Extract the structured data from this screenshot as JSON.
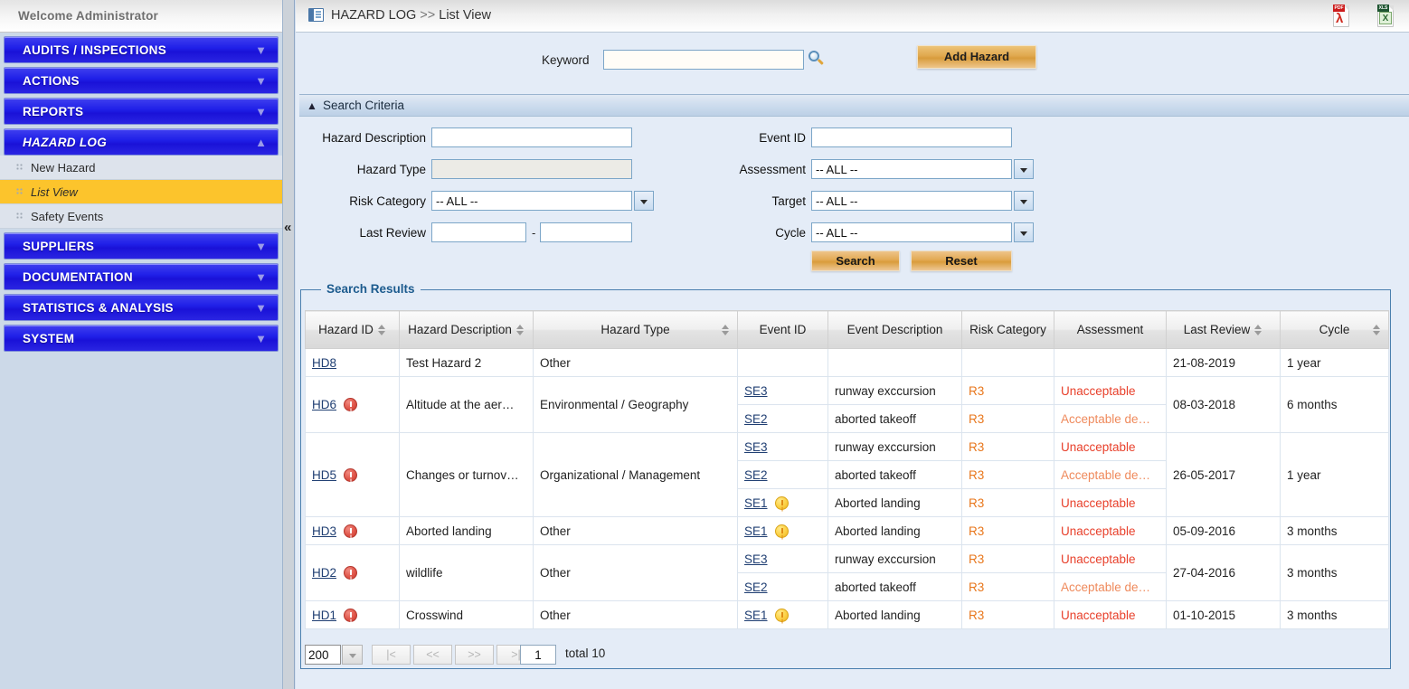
{
  "sidebar": {
    "welcome": "Welcome  Administrator",
    "groups": [
      {
        "label": "AUDITS / INSPECTIONS",
        "open": false,
        "chevron": "▼"
      },
      {
        "label": "ACTIONS",
        "open": false,
        "chevron": "▼"
      },
      {
        "label": "REPORTS",
        "open": false,
        "chevron": "▼"
      },
      {
        "label": "HAZARD LOG",
        "open": true,
        "chevron": "▲"
      },
      {
        "label": "SUPPLIERS",
        "open": false,
        "chevron": "▼"
      },
      {
        "label": "DOCUMENTATION",
        "open": false,
        "chevron": "▼"
      },
      {
        "label": "STATISTICS & ANALYSIS",
        "open": false,
        "chevron": "▼"
      },
      {
        "label": "SYSTEM",
        "open": false,
        "chevron": "▼"
      }
    ],
    "hazard_log_items": [
      {
        "label": "New Hazard",
        "active": false
      },
      {
        "label": "List View",
        "active": true
      },
      {
        "label": "Safety Events",
        "active": false
      }
    ],
    "collapse_glyph": "«"
  },
  "titlebar": {
    "breadcrumb_root": "HAZARD LOG",
    "breadcrumb_sep": ">>",
    "breadcrumb_leaf": "List View",
    "pdf_tag": "PDF",
    "pdf_glyph": "λ",
    "xls_tag": "XLS",
    "xls_glyph": "X"
  },
  "keyword_bar": {
    "label": "Keyword",
    "value": "",
    "placeholder": "",
    "add_hazard_label": "Add Hazard"
  },
  "criteria": {
    "title": "Search Criteria",
    "caret": "▲",
    "hazard_description_label": "Hazard Description",
    "hazard_description_value": "",
    "hazard_type_label": "Hazard Type",
    "hazard_type_value": "",
    "risk_category_label": "Risk Category",
    "risk_category_value": "-- ALL --",
    "last_review_label": "Last Review",
    "last_review_from": "",
    "last_review_to": "",
    "last_review_sep": "-",
    "event_id_label": "Event ID",
    "event_id_value": "",
    "assessment_label": "Assessment",
    "assessment_value": "-- ALL --",
    "target_label": "Target",
    "target_value": "-- ALL --",
    "cycle_label": "Cycle",
    "cycle_value": "-- ALL --",
    "search_label": "Search",
    "reset_label": "Reset"
  },
  "results": {
    "legend": "Search Results",
    "columns": [
      {
        "label": "Hazard ID",
        "sortable": true
      },
      {
        "label": "Hazard Description",
        "sortable": true
      },
      {
        "label": "Hazard Type",
        "sortable": true
      },
      {
        "label": "Event ID",
        "sortable": false
      },
      {
        "label": "Event Description",
        "sortable": false
      },
      {
        "label": "Risk Category",
        "sortable": false
      },
      {
        "label": "Assessment",
        "sortable": false
      },
      {
        "label": "Last Review",
        "sortable": true
      },
      {
        "label": "Cycle",
        "sortable": true
      }
    ],
    "rows": [
      {
        "hazard_id": "HD8",
        "hazard_flag": false,
        "hazard_description": "Test Hazard 2",
        "hazard_type": "Other",
        "last_review": "21-08-2019",
        "cycle": "1 year",
        "events": [
          {
            "event_id": "",
            "event_flag": false,
            "event_description": "",
            "risk_category": "",
            "assessment": "",
            "assessment_kind": ""
          }
        ]
      },
      {
        "hazard_id": "HD6",
        "hazard_flag": true,
        "hazard_description": "Altitude at the aer…",
        "hazard_type": "Environmental / Geography",
        "last_review": "08-03-2018",
        "cycle": "6 months",
        "events": [
          {
            "event_id": "SE3",
            "event_flag": false,
            "event_description": "runway exccursion",
            "risk_category": "R3",
            "assessment": "Unacceptable",
            "assessment_kind": "unacc"
          },
          {
            "event_id": "SE2",
            "event_flag": false,
            "event_description": "aborted takeoff",
            "risk_category": "R3",
            "assessment": "Acceptable de…",
            "assessment_kind": "acc"
          }
        ]
      },
      {
        "hazard_id": "HD5",
        "hazard_flag": true,
        "hazard_description": "Changes or turnov…",
        "hazard_type": "Organizational / Management",
        "last_review": "26-05-2017",
        "cycle": "1 year",
        "events": [
          {
            "event_id": "SE3",
            "event_flag": false,
            "event_description": "runway exccursion",
            "risk_category": "R3",
            "assessment": "Unacceptable",
            "assessment_kind": "unacc"
          },
          {
            "event_id": "SE2",
            "event_flag": false,
            "event_description": "aborted takeoff",
            "risk_category": "R3",
            "assessment": "Acceptable de…",
            "assessment_kind": "acc"
          },
          {
            "event_id": "SE1",
            "event_flag": true,
            "event_description": "Aborted landing",
            "risk_category": "R3",
            "assessment": "Unacceptable",
            "assessment_kind": "unacc"
          }
        ]
      },
      {
        "hazard_id": "HD3",
        "hazard_flag": true,
        "hazard_description": "Aborted landing",
        "hazard_type": "Other",
        "last_review": "05-09-2016",
        "cycle": "3 months",
        "events": [
          {
            "event_id": "SE1",
            "event_flag": true,
            "event_description": "Aborted landing",
            "risk_category": "R3",
            "assessment": "Unacceptable",
            "assessment_kind": "unacc"
          }
        ]
      },
      {
        "hazard_id": "HD2",
        "hazard_flag": true,
        "hazard_description": "wildlife",
        "hazard_type": "Other",
        "last_review": "27-04-2016",
        "cycle": "3 months",
        "events": [
          {
            "event_id": "SE3",
            "event_flag": false,
            "event_description": "runway exccursion",
            "risk_category": "R3",
            "assessment": "Unacceptable",
            "assessment_kind": "unacc"
          },
          {
            "event_id": "SE2",
            "event_flag": false,
            "event_description": "aborted takeoff",
            "risk_category": "R3",
            "assessment": "Acceptable de…",
            "assessment_kind": "acc"
          }
        ]
      },
      {
        "hazard_id": "HD1",
        "hazard_flag": true,
        "hazard_description": "Crosswind",
        "hazard_type": "Other",
        "last_review": "01-10-2015",
        "cycle": "3 months",
        "events": [
          {
            "event_id": "SE1",
            "event_flag": true,
            "event_description": "Aborted landing",
            "risk_category": "R3",
            "assessment": "Unacceptable",
            "assessment_kind": "unacc"
          }
        ]
      }
    ]
  },
  "pager": {
    "page_size": "200",
    "first_label": "|<",
    "prev_label": "<<",
    "next_label": ">>",
    "last_label": ">|",
    "page_number": "1",
    "total_label": "total 10"
  },
  "colors": {
    "nav_blue": "#2020e8",
    "active_yellow": "#fcc42c",
    "gold_button": "#e0a84e",
    "link": "#1f3e72",
    "risk_orange": "#e8761b",
    "unacceptable_red": "#e8402b",
    "acceptable_orange": "#ef8a5c",
    "legend_blue": "#1c5b8e"
  }
}
